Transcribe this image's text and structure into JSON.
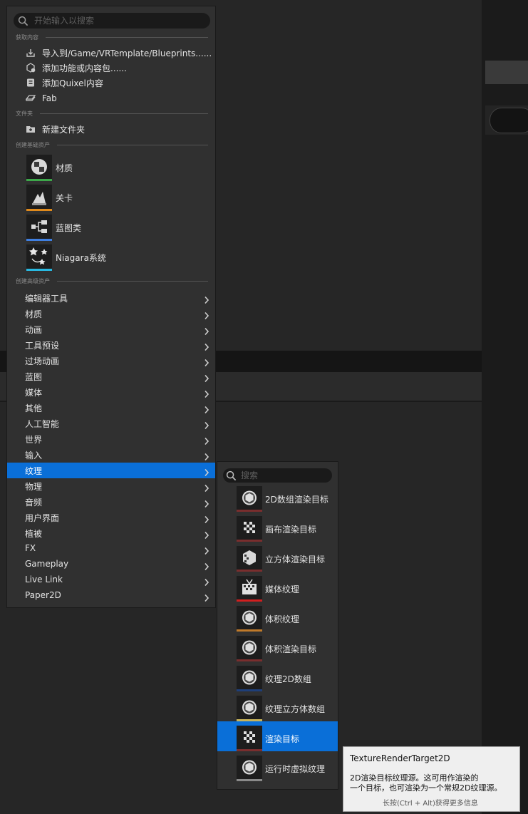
{
  "search": {
    "placeholder": "开始输入以搜索"
  },
  "sections": {
    "get_content": "获取内容",
    "folder": "文件夹",
    "basic_assets": "创建基础资产",
    "advanced_assets": "创建高级资产"
  },
  "get_content_items": [
    {
      "label": "导入到/Game/VRTemplate/Blueprints......",
      "icon": "import-icon"
    },
    {
      "label": "添加功能或内容包......",
      "icon": "feature-pack-icon"
    },
    {
      "label": "添加Quixel内容",
      "icon": "quixel-icon"
    },
    {
      "label": "Fab",
      "icon": "fab-icon"
    }
  ],
  "folder_item": {
    "label": "新建文件夹",
    "icon": "new-folder-icon"
  },
  "basic_assets": [
    {
      "label": "材质",
      "icon": "material-icon",
      "color": "#3da84a"
    },
    {
      "label": "关卡",
      "icon": "level-icon",
      "color": "#e08a1c"
    },
    {
      "label": "蓝图类",
      "icon": "blueprint-class-icon",
      "color": "#3f7fe0"
    },
    {
      "label": "Niagara系统",
      "icon": "niagara-system-icon",
      "color": "#29b8e0"
    }
  ],
  "categories": [
    "编辑器工具",
    "材质",
    "动画",
    "工具预设",
    "过场动画",
    "蓝图",
    "媒体",
    "其他",
    "人工智能",
    "世界",
    "输入",
    "纹理",
    "物理",
    "音频",
    "用户界面",
    "植被",
    "FX",
    "Gameplay",
    "Live Link",
    "Paper2D"
  ],
  "selected_category": "纹理",
  "submenu": {
    "search_placeholder": "搜索",
    "items": [
      {
        "label": "2D数组渲染目标",
        "icon": "render-target-array-icon",
        "color": "#7a2e2e"
      },
      {
        "label": "画布渲染目标",
        "icon": "canvas-render-target-icon",
        "color": "#7a2e2e"
      },
      {
        "label": "立方体渲染目标",
        "icon": "cube-render-target-icon",
        "color": "#7a2e2e"
      },
      {
        "label": "媒体纹理",
        "icon": "media-texture-icon",
        "color": "#d11f1f"
      },
      {
        "label": "体积纹理",
        "icon": "volume-texture-icon",
        "color": "#c07a2a"
      },
      {
        "label": "体积渲染目标",
        "icon": "volume-render-target-icon",
        "color": "#7a2e2e"
      },
      {
        "label": "纹理2D数组",
        "icon": "texture-2d-array-icon",
        "color": "#1e3f7a"
      },
      {
        "label": "纹理立方体数组",
        "icon": "texture-cube-array-icon",
        "color": "#c9b45a"
      },
      {
        "label": "渲染目标",
        "icon": "render-target-icon",
        "color": "#7a2e2e"
      },
      {
        "label": "运行时虚拟纹理",
        "icon": "runtime-virtual-texture-icon",
        "color": "#8a8a8a"
      }
    ],
    "selected": "渲染目标"
  },
  "tooltip": {
    "title": "TextureRenderTarget2D",
    "line1": "2D渲染目标纹理源。这可用作渲染的",
    "line2": "一个目标，也可渲染为一个常规2D纹理源。",
    "hint": "长按(Ctrl + Alt)获得更多信息"
  }
}
